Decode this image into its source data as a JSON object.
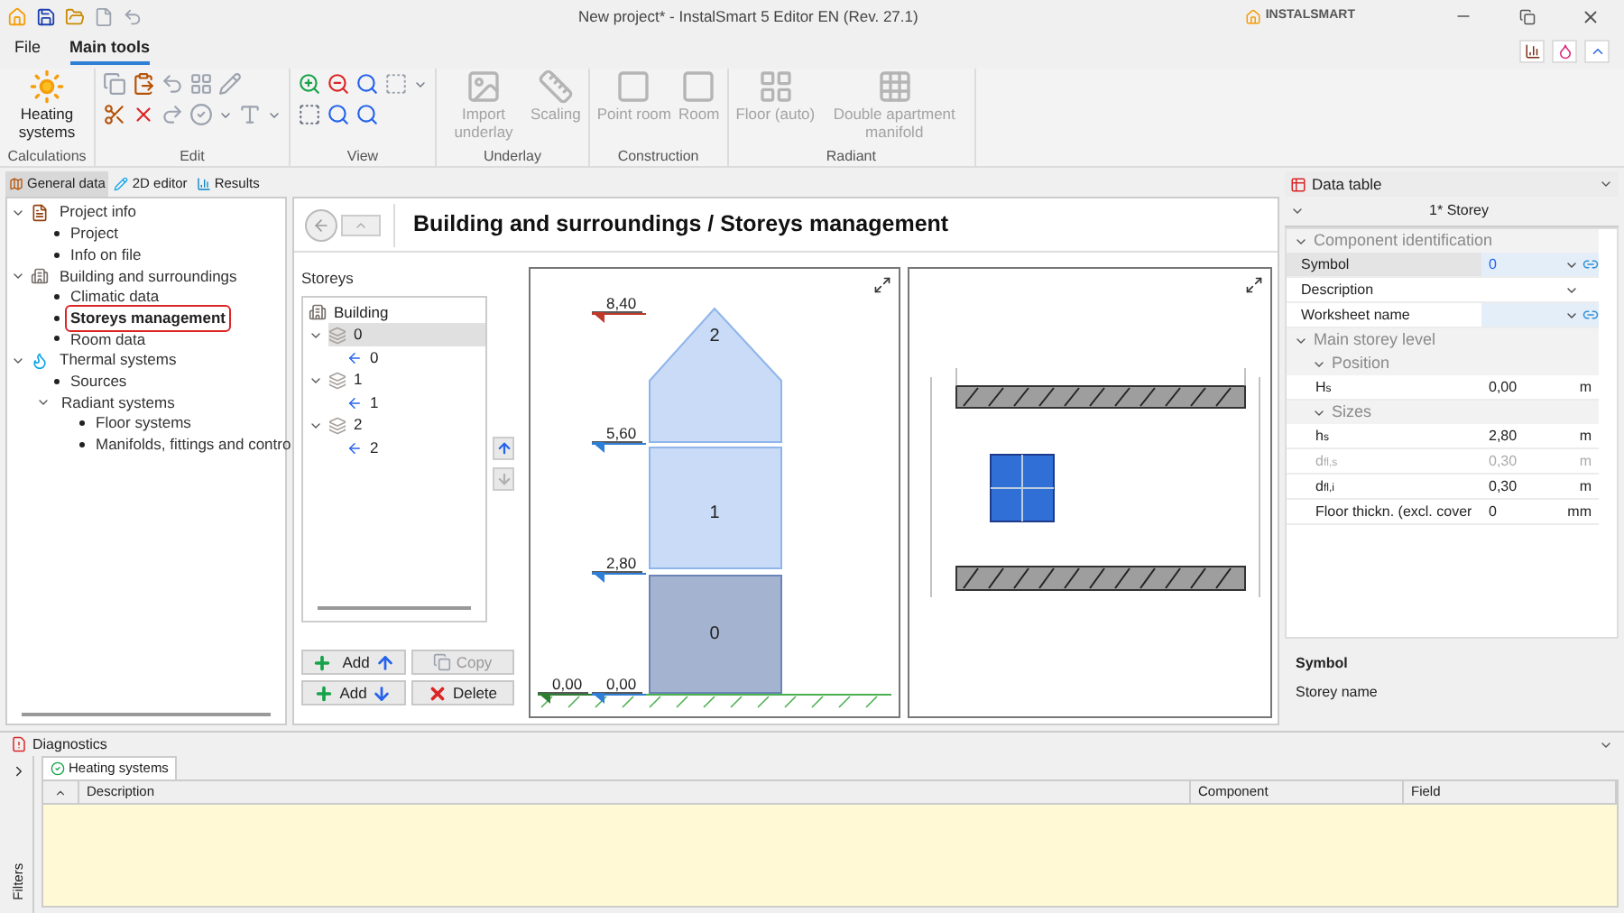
{
  "window": {
    "title": "New project* - InstalSmart 5 Editor EN (Rev. 27.1)",
    "brand": "INSTALSMART"
  },
  "menu_tabs": [
    {
      "label": "File",
      "selected": false
    },
    {
      "label": "Main tools",
      "selected": true
    }
  ],
  "ribbon": [
    {
      "label": "Calculations",
      "kind": "large",
      "tools": [
        {
          "label": "Heating systems",
          "disabled": false
        }
      ]
    },
    {
      "label": "Edit",
      "kind": "edit"
    },
    {
      "label": "View",
      "kind": "view"
    },
    {
      "label": "Underlay",
      "kind": "large",
      "tools": [
        {
          "label": "Import underlay",
          "disabled": true
        },
        {
          "label": "Scaling",
          "disabled": true
        }
      ]
    },
    {
      "label": "Construction",
      "kind": "large",
      "tools": [
        {
          "label": "Point room",
          "disabled": true
        },
        {
          "label": "Room",
          "disabled": true
        }
      ]
    },
    {
      "label": "Radiant",
      "kind": "large",
      "tools": [
        {
          "label": "Floor (auto)",
          "disabled": true
        },
        {
          "label": "Double apartment manifold",
          "disabled": true
        }
      ]
    }
  ],
  "left_tabs": [
    {
      "label": "General data",
      "selected": true
    },
    {
      "label": "2D editor",
      "selected": false
    },
    {
      "label": "Results",
      "selected": false
    }
  ],
  "tree": [
    {
      "label": "Project info",
      "expanded": true,
      "selected": false,
      "children": [
        {
          "label": "Project",
          "selected": false
        },
        {
          "label": "Info on file",
          "selected": false
        }
      ]
    },
    {
      "label": "Building and surroundings",
      "expanded": true,
      "selected": false,
      "children": [
        {
          "label": "Climatic data",
          "selected": false
        },
        {
          "label": "Storeys management",
          "selected": true
        },
        {
          "label": "Room data",
          "selected": false
        }
      ]
    },
    {
      "label": "Thermal systems",
      "expanded": true,
      "selected": false,
      "children": [
        {
          "label": "Sources",
          "selected": false
        },
        {
          "label": "Radiant systems",
          "expanded": true,
          "selected": false,
          "children": [
            {
              "label": "Floor systems",
              "selected": false
            },
            {
              "label": "Manifolds, fittings and contro",
              "selected": false
            }
          ]
        }
      ]
    }
  ],
  "page_title": "Building and surroundings / Storeys management",
  "storeys": {
    "label": "Storeys",
    "root": "Building",
    "items": [
      {
        "label": "0",
        "expanded": true,
        "selected": true,
        "children": [
          {
            "label": "0",
            "selected": false
          }
        ]
      },
      {
        "label": "1",
        "expanded": true,
        "selected": false,
        "children": [
          {
            "label": "1",
            "selected": false
          }
        ]
      },
      {
        "label": "2",
        "expanded": true,
        "selected": false,
        "children": [
          {
            "label": "2",
            "selected": false
          }
        ]
      }
    ],
    "move_up": {
      "disabled": false
    },
    "move_down": {
      "disabled": true
    },
    "buttons": [
      {
        "label": "Add",
        "kind": "add_up",
        "disabled": false
      },
      {
        "label": "Copy",
        "kind": "copy",
        "disabled": true
      },
      {
        "label": "Add",
        "kind": "add_down",
        "disabled": false
      },
      {
        "label": "Delete",
        "kind": "delete",
        "disabled": false
      }
    ]
  },
  "elevation": {
    "levels": [
      {
        "label": "8,40",
        "color": "#c0392b"
      },
      {
        "label": "5,60",
        "color": "#2f7fd6"
      },
      {
        "label": "2,80",
        "color": "#2f7fd6"
      },
      {
        "label": "0,00",
        "color": "#2e7d32"
      },
      {
        "label": "0,00",
        "color": "#2f7fd6"
      }
    ],
    "storeys": [
      {
        "label": "2",
        "selected": false
      },
      {
        "label": "1",
        "selected": false
      },
      {
        "label": "0",
        "selected": true
      }
    ]
  },
  "data_table": {
    "title": "Data table",
    "subtitle": "1* Storey",
    "sections": [
      {
        "label": "Component identification",
        "expanded": true,
        "rows": [
          {
            "label": "Symbol",
            "value": "0",
            "kind": "dropdown",
            "linked": true,
            "selected": true,
            "disabled": false
          },
          {
            "label": "Description",
            "kind": "dropdown",
            "linked": false,
            "selected": false,
            "disabled": false
          },
          {
            "label": "Worksheet name",
            "kind": "dropdown",
            "linked": true,
            "selected": false,
            "disabled": false
          }
        ]
      },
      {
        "label": "Main storey level",
        "expanded": true,
        "children": [
          {
            "label": "Position",
            "expanded": true,
            "rows": [
              {
                "label": "H$_{s}$",
                "value": "0,00",
                "unit": "m",
                "kind": "number",
                "linked": false,
                "selected": false,
                "disabled": false
              }
            ]
          },
          {
            "label": "Sizes",
            "expanded": true,
            "rows": [
              {
                "label": "h$_{s}$",
                "value": "2,80",
                "unit": "m",
                "kind": "number",
                "linked": false,
                "selected": false,
                "disabled": false
              },
              {
                "label": "d$_{fl,s}$",
                "value": "0,30",
                "unit": "m",
                "kind": "number",
                "linked": false,
                "selected": false,
                "disabled": true
              },
              {
                "label": "d$_{fl,i}$",
                "value": "0,30",
                "unit": "m",
                "kind": "number",
                "linked": false,
                "selected": false,
                "disabled": false
              },
              {
                "label": "Floor thickn. (excl. cover",
                "value": "0",
                "unit": "mm",
                "kind": "number",
                "linked": false,
                "selected": false,
                "disabled": false
              }
            ]
          }
        ]
      }
    ],
    "help_title": "Symbol",
    "help_text": "Storey name"
  },
  "diagnostics": {
    "title": "Diagnostics",
    "filters_label": "Filters",
    "tab": "Heating systems",
    "columns": [
      "Description",
      "Component",
      "Field"
    ]
  }
}
